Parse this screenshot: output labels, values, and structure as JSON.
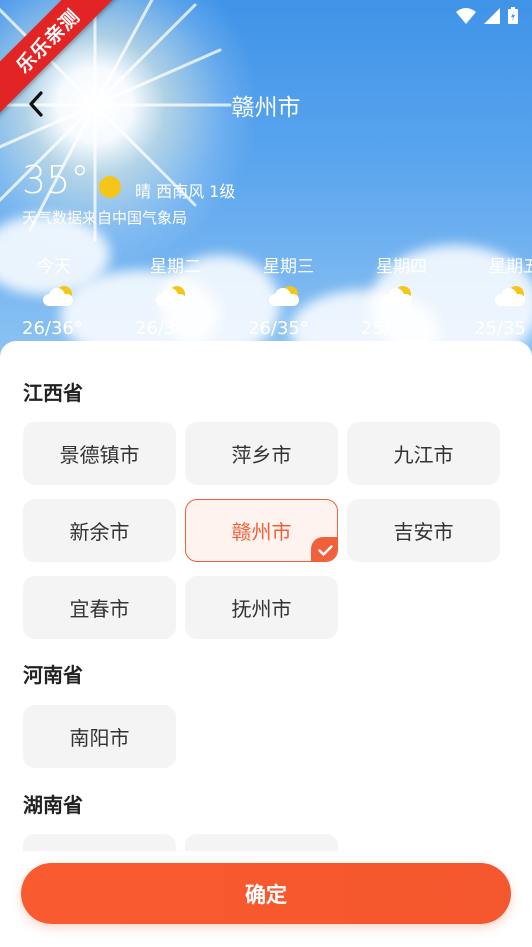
{
  "watermark": "乐乐亲测",
  "header": {
    "title": "赣州市"
  },
  "weather": {
    "temperature": "35°",
    "condition": "晴 西南风 1级",
    "source": "天气数据来自中国气象局",
    "forecast": [
      {
        "day": "今天",
        "range": "26/36°"
      },
      {
        "day": "星期二",
        "range": "26/36°"
      },
      {
        "day": "星期三",
        "range": "26/35°"
      },
      {
        "day": "星期四",
        "range": "25/35°"
      },
      {
        "day": "星期五",
        "range": "25/35"
      }
    ]
  },
  "provinces": [
    {
      "name": "江西省",
      "cities": [
        "景德镇市",
        "萍乡市",
        "九江市",
        "新余市",
        "赣州市",
        "吉安市",
        "宜春市",
        "抚州市"
      ]
    },
    {
      "name": "河南省",
      "cities": [
        "南阳市"
      ]
    },
    {
      "name": "湖南省",
      "cities": []
    }
  ],
  "selected_city": "赣州市",
  "confirm_label": "确定",
  "colors": {
    "accent": "#f0603a",
    "button": "#f5572e",
    "sky": "#4a9ae9"
  }
}
